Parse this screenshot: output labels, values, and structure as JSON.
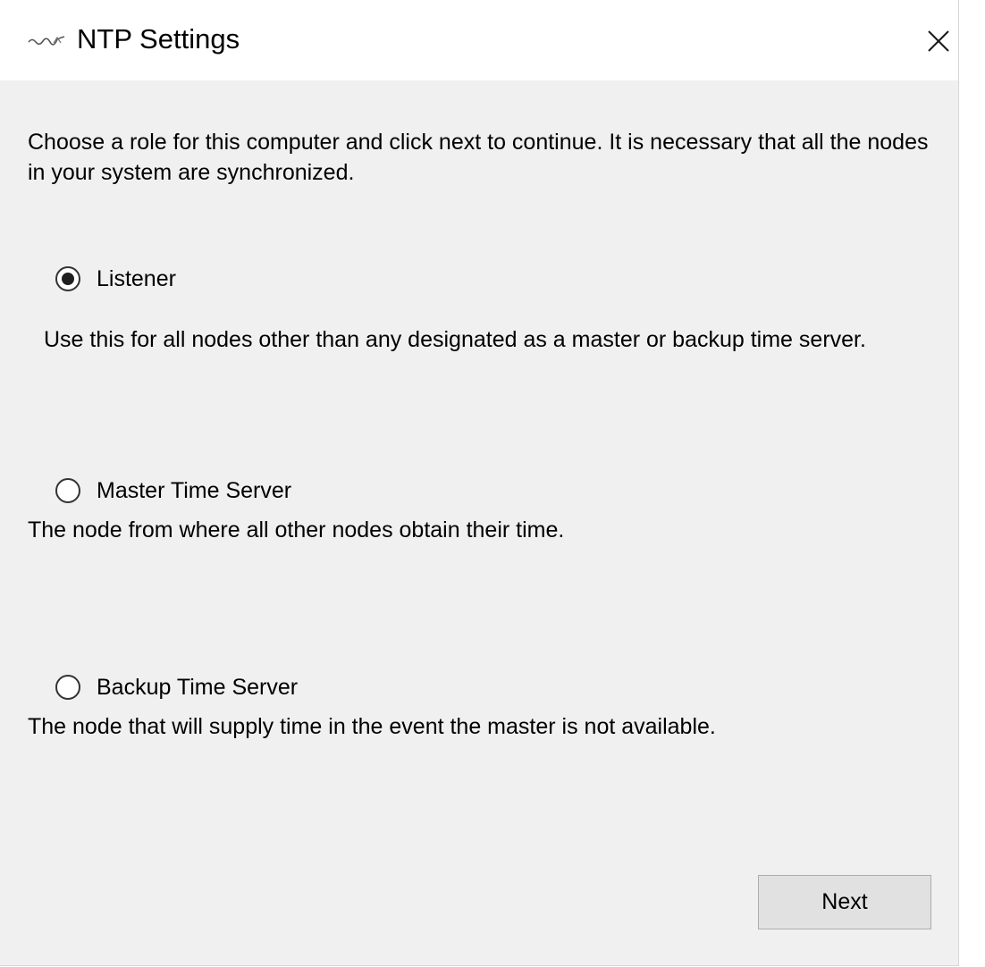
{
  "window": {
    "title": "NTP Settings",
    "logo_icon": "app-logo-icon",
    "close_glyph": "×"
  },
  "intro_text": "Choose a role for this computer and click next to continue. It is necessary that all the nodes in your system are synchronized.",
  "roles": [
    {
      "label": "Listener",
      "description": "Use this for all nodes other than any designated as a master or backup time server.",
      "selected": true
    },
    {
      "label": "Master Time Server",
      "description": "The node from where all other nodes obtain their time.",
      "selected": false
    },
    {
      "label": "Backup Time Server",
      "description": "The node that will supply time in the event the master is not available.",
      "selected": false
    }
  ],
  "buttons": {
    "next_label": "Next"
  },
  "colors": {
    "window_bg": "#f0f0f0",
    "titlebar_bg": "#ffffff",
    "button_bg": "#e1e1e1",
    "button_border": "#adadad"
  }
}
